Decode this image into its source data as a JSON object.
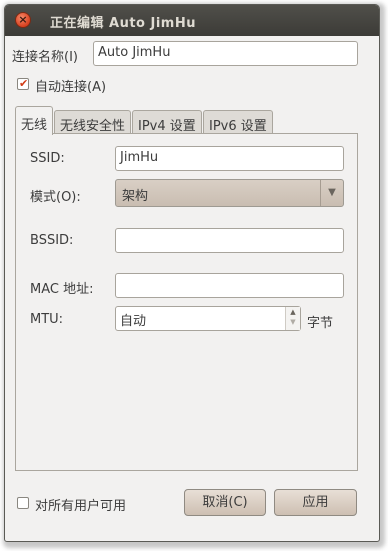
{
  "titlebar": {
    "title": "正在编辑 Auto JimHu",
    "close_glyph": "×"
  },
  "connection": {
    "name_label": "连接名称(I)",
    "name_value": "Auto JimHu"
  },
  "autoconnect": {
    "label": "自动连接(A)",
    "checked": true
  },
  "tabs": [
    {
      "label": "无线",
      "active": true
    },
    {
      "label": "无线安全性",
      "active": false
    },
    {
      "label": "IPv4 设置",
      "active": false
    },
    {
      "label": "IPv6 设置",
      "active": false
    }
  ],
  "wireless": {
    "ssid_label": "SSID:",
    "ssid_value": "JimHu",
    "mode_label": "模式(O):",
    "mode_value": "架构",
    "bssid_label": "BSSID:",
    "bssid_value": "",
    "mac_label": "MAC 地址:",
    "mac_value": "",
    "mtu_label": "MTU:",
    "mtu_value": "自动",
    "mtu_unit": "字节"
  },
  "footer": {
    "all_users_label": "对所有用户可用",
    "all_users_checked": false,
    "cancel_label": "取消(C)",
    "apply_label": "应用"
  },
  "icons": {
    "close": "close-icon",
    "combo": "chevron-down-icon",
    "spin_up": "arrow-up-icon",
    "spin_down": "arrow-down-icon"
  },
  "colors": {
    "titlebar": "#3c3b37",
    "window_bg": "#f2f1f0",
    "close_button": "#d7401f",
    "check": "#d23b14"
  }
}
